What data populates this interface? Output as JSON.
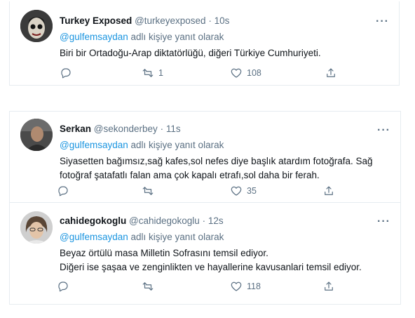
{
  "tweets": [
    {
      "name": "Turkey Exposed",
      "handle": "@turkeyexposed",
      "time": "· 10s",
      "more": "···",
      "reply_mention": "@gulfemsaydan",
      "reply_suffix": " adlı kişiye yanıt olarak",
      "lines": [
        "Biri bir Ortadoğu-Arap diktatörlüğü, diğeri Türkiye Cumhuriyeti."
      ],
      "retweets": "1",
      "likes": "108"
    },
    {
      "name": "Serkan",
      "handle": "@sekonderbey",
      "time": "· 11s",
      "more": "···",
      "reply_mention": "@gulfemsaydan",
      "reply_suffix": " adlı kişiye yanıt olarak",
      "lines": [
        "Siyasetten bağımsız,sağ kafes,sol nefes diye başlık atardım fotoğrafa. Sağ",
        "fotoğraf şatafatlı falan ama çok kapalı etrafı,sol daha bir ferah."
      ],
      "retweets": "",
      "likes": "35"
    },
    {
      "name": "cahidegokoglu",
      "handle": "@cahidegokoglu",
      "time": "· 12s",
      "more": "···",
      "reply_mention": "@gulfemsaydan",
      "reply_suffix": " adlı kişiye yanıt olarak",
      "lines": [
        "Beyaz örtülü masa Milletin Sofrasını temsil  ediyor.",
        "Diğeri ise  şaşaa ve zenginlikten ve hayallerine kavusanlari temsil ediyor."
      ],
      "retweets": "",
      "likes": "118"
    }
  ],
  "icons": {
    "reply": "reply-icon",
    "retweet": "retweet-icon",
    "like": "heart-icon",
    "share": "share-icon",
    "more": "more-icon"
  },
  "colors": {
    "mention": "#1b95e0",
    "secondary": "#5b7083",
    "border": "#e6ecf0"
  }
}
